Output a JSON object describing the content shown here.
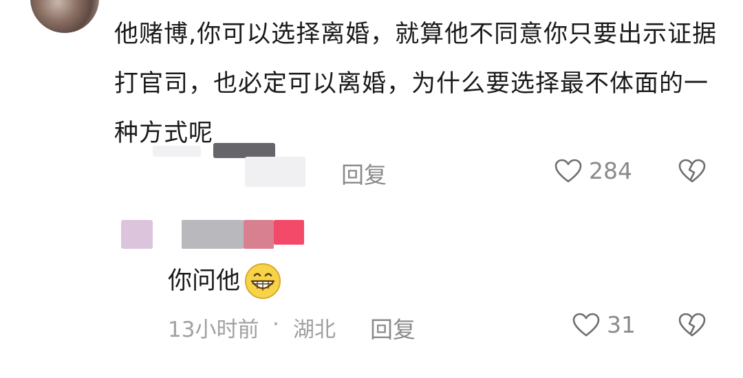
{
  "comment": {
    "text": "他赌博,你可以选择离婚，就算他不同意你只要出示证据打官司，也必定可以离婚，为什么要选择最不体面的一种方式呢",
    "reply_label": "回复",
    "like_count": "284",
    "icons": {
      "like": "heart-outline-icon",
      "dislike": "broken-heart-icon"
    }
  },
  "reply": {
    "text": "你问他",
    "emoji": "grinning-face-icon",
    "time": "13小时前",
    "separator": "·",
    "location": "湖北",
    "reply_label": "回复",
    "like_count": "31"
  },
  "colors": {
    "text_primary": "#1a1a1a",
    "text_meta": "#8a8a8a",
    "emoji_yellow": "#f7d348"
  }
}
